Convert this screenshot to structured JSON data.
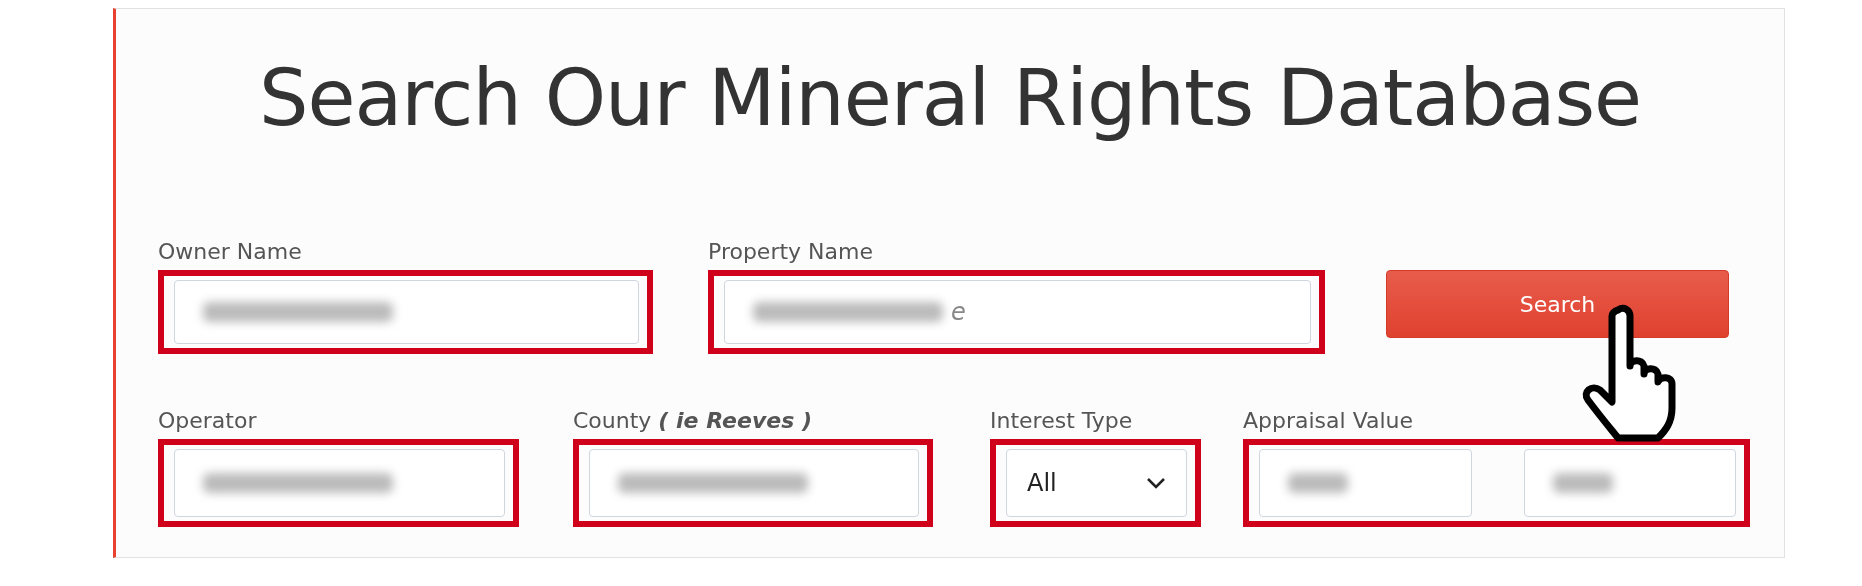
{
  "title": "Search Our Mineral Rights Database",
  "rows": [
    [
      {
        "kind": "text",
        "label": "Owner Name",
        "highlighted": true,
        "blurred": true
      },
      {
        "kind": "text",
        "label": "Property Name",
        "highlighted": true,
        "blurred": true,
        "visible_tail": "e"
      },
      {
        "kind": "button",
        "label": "Search"
      }
    ],
    [
      {
        "kind": "text",
        "label": "Operator",
        "highlighted": true,
        "blurred": true
      },
      {
        "kind": "text",
        "label": "County",
        "hint": "( ie Reeves )",
        "highlighted": true,
        "blurred": true
      },
      {
        "kind": "select",
        "label": "Interest Type",
        "value": "All",
        "highlighted": true
      },
      {
        "kind": "range",
        "label": "Appraisal Value",
        "highlighted": true,
        "parts": [
          {
            "blurred": true
          },
          {
            "blurred": true
          }
        ]
      }
    ]
  ]
}
